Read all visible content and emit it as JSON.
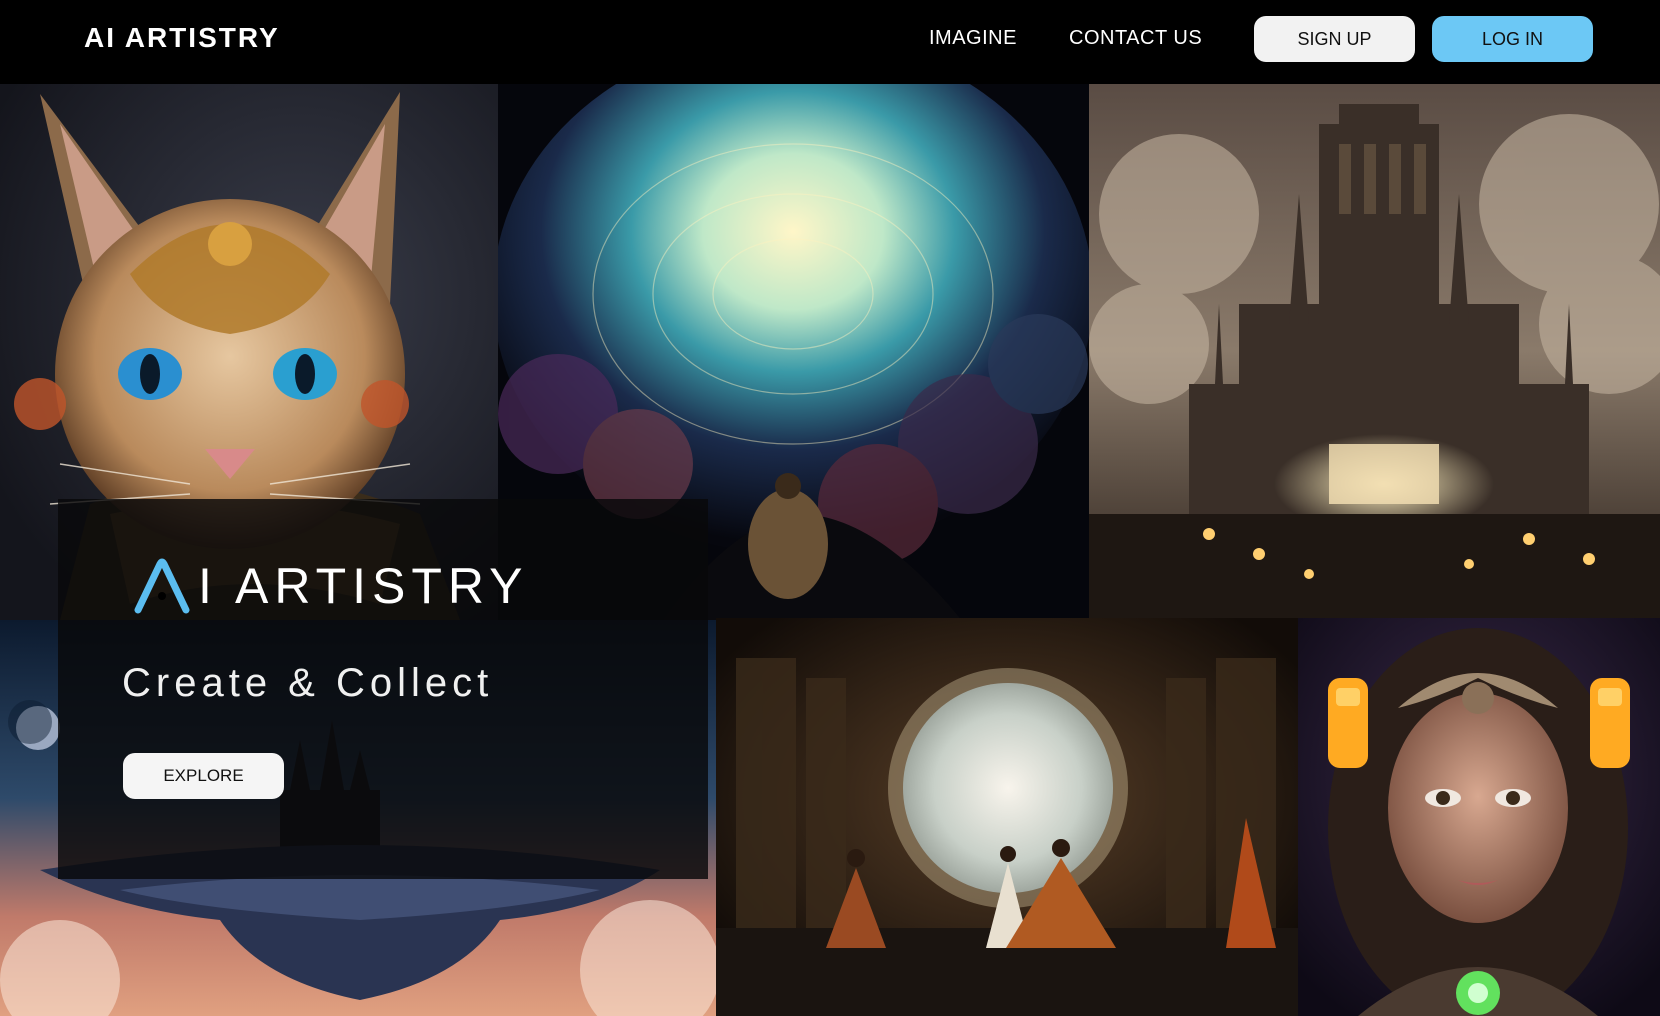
{
  "header": {
    "brand": "AI ARTISTRY",
    "nav": [
      "IMAGINE",
      "CONTACT US"
    ],
    "signup_label": "SIGN UP",
    "login_label": "LOG IN"
  },
  "hero": {
    "logo_text": "I ARTISTRY",
    "tagline": "Create & Collect",
    "explore_label": "EXPLORE"
  },
  "colors": {
    "header_bg": "#000000",
    "login_button": "#6cc8f5",
    "signup_button": "#f2f2f2",
    "logo_mark": "#5bbdf0"
  }
}
